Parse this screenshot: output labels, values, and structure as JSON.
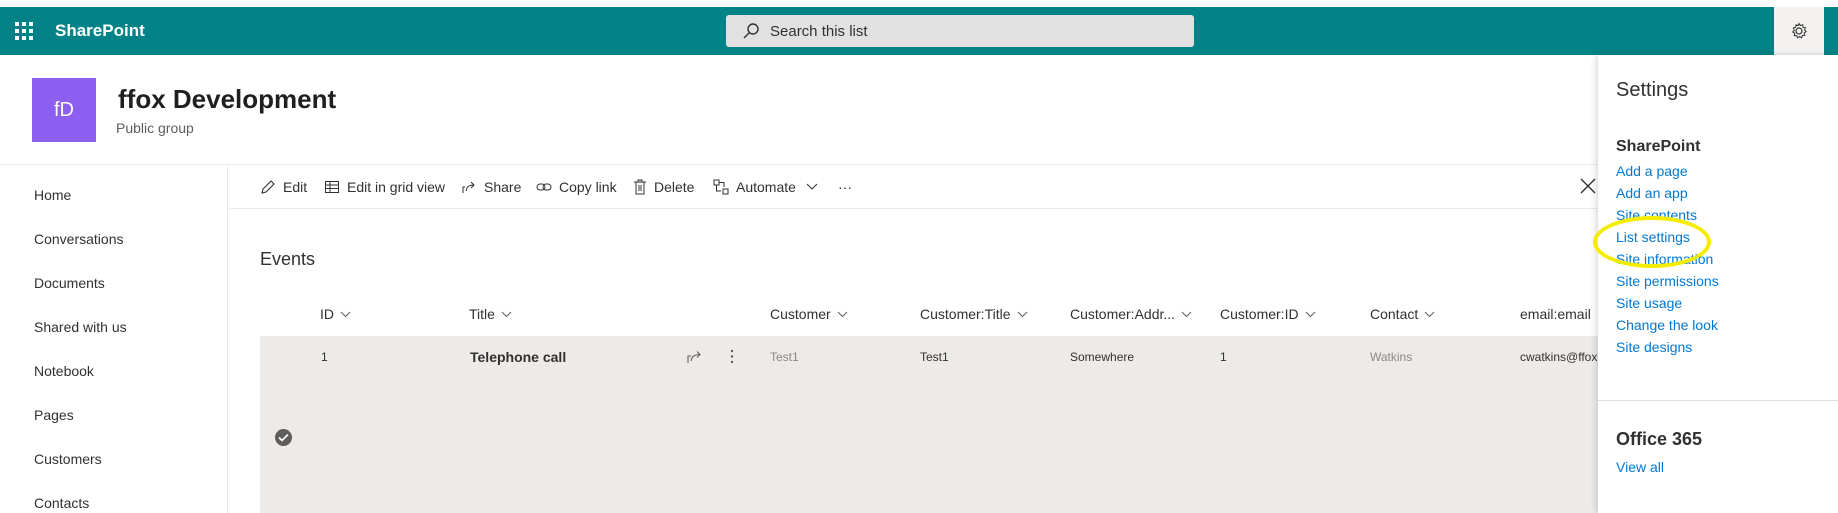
{
  "suitebar": {
    "brand": "SharePoint",
    "search_placeholder": "Search this list"
  },
  "site": {
    "logo_initials": "fD",
    "title": "ffox Development",
    "subtitle": "Public group"
  },
  "leftnav": {
    "items": [
      {
        "label": "Home"
      },
      {
        "label": "Conversations"
      },
      {
        "label": "Documents"
      },
      {
        "label": "Shared with us"
      },
      {
        "label": "Notebook"
      },
      {
        "label": "Pages"
      },
      {
        "label": "Customers"
      },
      {
        "label": "Contacts"
      }
    ]
  },
  "commandbar": {
    "edit": "Edit",
    "edit_grid": "Edit in grid view",
    "share": "Share",
    "copy_link": "Copy link",
    "delete": "Delete",
    "automate": "Automate",
    "more": "···"
  },
  "list": {
    "title": "Events",
    "columns": [
      "ID",
      "Title",
      "Customer",
      "Customer:Title",
      "Customer:Addr...",
      "Customer:ID",
      "Contact",
      "email:email"
    ],
    "rows": [
      {
        "id": "1",
        "title": "Telephone call",
        "customer": "Test1",
        "customer_title": "Test1",
        "customer_address": "Somewhere",
        "customer_id": "1",
        "contact": "Watkins",
        "email": "cwatkins@ffox."
      }
    ]
  },
  "settings_panel": {
    "title": "Settings",
    "sharepoint_section": "SharePoint",
    "sharepoint_links": [
      "Add a page",
      "Add an app",
      "Site contents",
      "List settings",
      "Site information",
      "Site permissions",
      "Site usage",
      "Change the look",
      "Site designs"
    ],
    "office_section": "Office 365",
    "office_link": "View all"
  },
  "colors": {
    "suitebar": "#038387",
    "site_logo": "#8c5ff0",
    "link": "#0078d4",
    "highlight": "#f5ec00",
    "row_selected": "#edebe9"
  },
  "icons": [
    "waffle-icon",
    "search-icon",
    "gear-icon",
    "pencil-icon",
    "grid-icon",
    "share-icon",
    "link-icon",
    "trash-icon",
    "automate-icon",
    "chevron-down-icon",
    "close-icon",
    "checkmark-icon",
    "more-vertical-icon"
  ]
}
